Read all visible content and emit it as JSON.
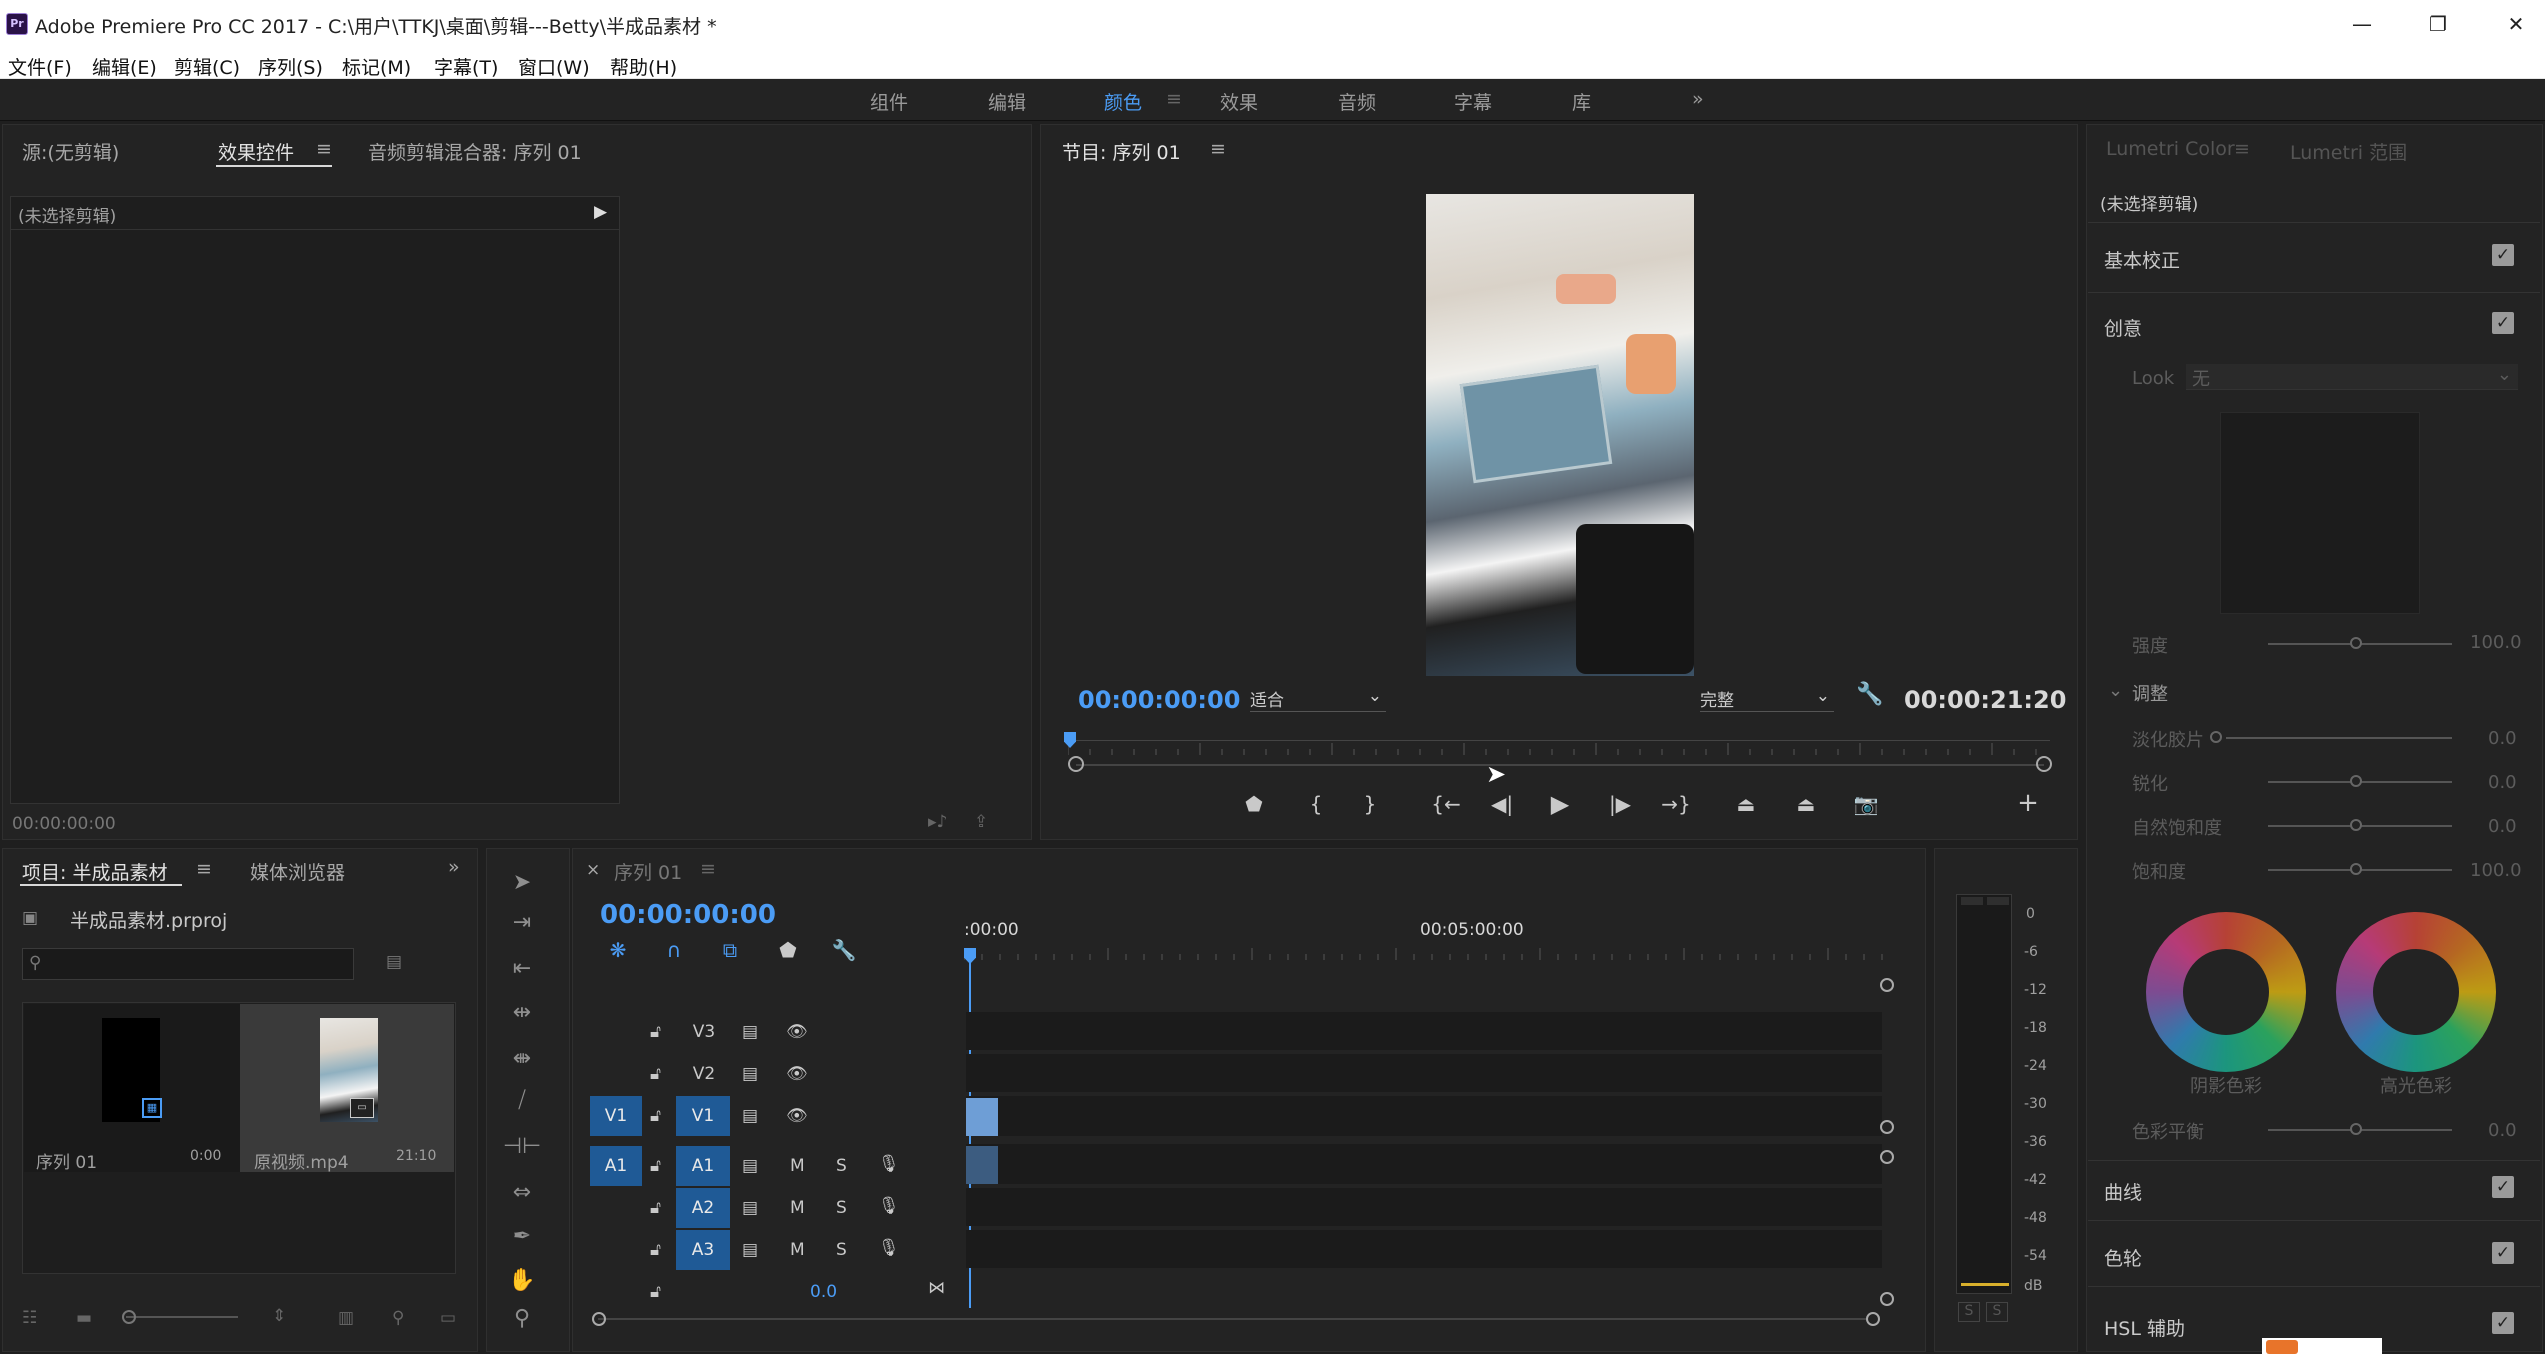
{
  "window": {
    "title": "Adobe Premiere Pro CC 2017 - C:\\用户\\TTKJ\\桌面\\剪辑---Betty\\半成品素材 *",
    "app_icon": "Pr",
    "minimize": "—",
    "restore": "❐",
    "close": "✕"
  },
  "menu": [
    "文件(F)",
    "编辑(E)",
    "剪辑(C)",
    "序列(S)",
    "标记(M)",
    "字幕(T)",
    "窗口(W)",
    "帮助(H)"
  ],
  "workspaces": {
    "tabs": [
      "组件",
      "编辑",
      "颜色",
      "效果",
      "音频",
      "字幕",
      "库"
    ],
    "active": "颜色",
    "more": "»"
  },
  "source_panel": {
    "tabs": [
      "源:(无剪辑)",
      "效果控件",
      "音频剪辑混合器: 序列 01"
    ],
    "active": "效果控件",
    "no_clip": "(未选择剪辑)",
    "timecode": "00:00:00:00"
  },
  "program_panel": {
    "title": "节目: 序列 01",
    "current_time": "00:00:00:00",
    "fit": "适合",
    "quality": "完整",
    "duration": "00:00:21:20",
    "add": "+"
  },
  "project_panel": {
    "tabs": [
      "项目: 半成品素材",
      "媒体浏览器"
    ],
    "file": "半成品素材.prproj",
    "search_placeholder": "",
    "items": [
      {
        "name": "序列 01",
        "duration": "0:00"
      },
      {
        "name": "原视频.mp4",
        "duration": "21:10"
      }
    ]
  },
  "timeline": {
    "tab": "序列 01",
    "timecode": "00:00:00:00",
    "ruler": [
      ":00:00",
      "00:05:00:00"
    ],
    "video_tracks": [
      {
        "name": "V3",
        "target": ""
      },
      {
        "name": "V2",
        "target": ""
      },
      {
        "name": "V1",
        "target": "V1"
      }
    ],
    "audio_tracks": [
      {
        "name": "A1",
        "target": "A1"
      },
      {
        "name": "A2",
        "target": ""
      },
      {
        "name": "A3",
        "target": ""
      }
    ],
    "mute": "M",
    "solo": "S",
    "master_value": "0.0"
  },
  "audio_meter": {
    "labels": [
      "0",
      "-6",
      "-12",
      "-18",
      "-24",
      "-30",
      "-36",
      "-42",
      "-48",
      "-54",
      "dB"
    ],
    "solo_left": "S",
    "solo_right": "S"
  },
  "lumetri": {
    "tabs": [
      "Lumetri Color",
      "Lumetri 范围"
    ],
    "no_clip": "(未选择剪辑)",
    "basic": "基本校正",
    "creative": "创意",
    "look_label": "Look",
    "look_value": "无",
    "intensity": {
      "label": "强度",
      "value": "100.0"
    },
    "adjust": "调整",
    "faded_film": {
      "label": "淡化胶片",
      "value": "0.0"
    },
    "sharpen": {
      "label": "锐化",
      "value": "0.0"
    },
    "vibrance": {
      "label": "自然饱和度",
      "value": "0.0"
    },
    "saturation": {
      "label": "饱和度",
      "value": "100.0"
    },
    "shadow_tint": "阴影色彩",
    "highlight_tint": "高光色彩",
    "tint_balance": {
      "label": "色彩平衡",
      "value": "0.0"
    },
    "curves": "曲线",
    "color_wheels": "色轮",
    "hsl": "HSL 辅助"
  },
  "colors": {
    "accent": "#4b9cf5",
    "panel": "#232323",
    "track_target": "#1f5a96"
  }
}
